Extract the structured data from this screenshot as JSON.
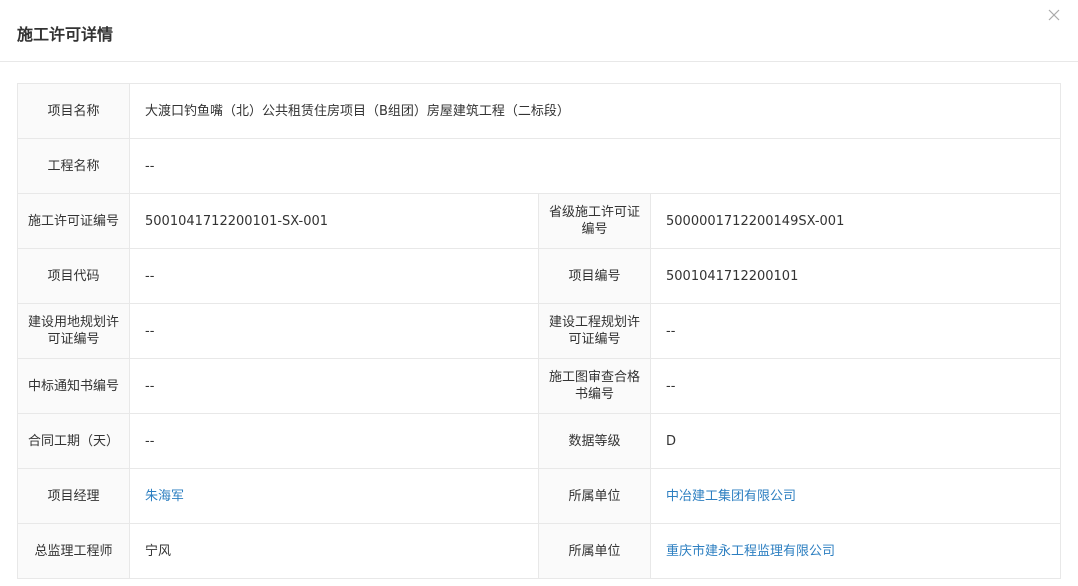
{
  "dialog": {
    "title": "施工许可详情",
    "close_icon": "close-icon"
  },
  "fields": {
    "project_name_label": "项目名称",
    "project_name": "大渡口钓鱼嘴（北）公共租赁住房项目（B组团）房屋建筑工程（二标段）",
    "engineering_name_label": "工程名称",
    "engineering_name": "--",
    "permit_no_label": "施工许可证编号",
    "permit_no": "5001041712200101-SX-001",
    "provincial_permit_no_label": "省级施工许可证编号",
    "provincial_permit_no": "5000001712200149SX-001",
    "project_code_label": "项目代码",
    "project_code": "--",
    "project_no_label": "项目编号",
    "project_no": "5001041712200101",
    "land_permit_no_label": "建设用地规划许可证编号",
    "land_permit_no": "--",
    "engineering_permit_no_label": "建设工程规划许可证编号",
    "engineering_permit_no": "--",
    "bid_notice_no_label": "中标通知书编号",
    "bid_notice_no": "--",
    "drawing_review_no_label": "施工图审查合格书编号",
    "drawing_review_no": "--",
    "contract_period_label": "合同工期（天）",
    "contract_period": "--",
    "data_level_label": "数据等级",
    "data_level": "D",
    "project_manager_label": "项目经理",
    "project_manager": "朱海军",
    "pm_unit_label": "所属单位",
    "pm_unit": "中冶建工集团有限公司",
    "chief_supervisor_label": "总监理工程师",
    "chief_supervisor": "宁风",
    "supervisor_unit_label": "所属单位",
    "supervisor_unit": "重庆市建永工程监理有限公司"
  },
  "colors": {
    "link": "#2d7fc1",
    "label_bg": "#fafafa",
    "border": "#e8e8e8"
  }
}
